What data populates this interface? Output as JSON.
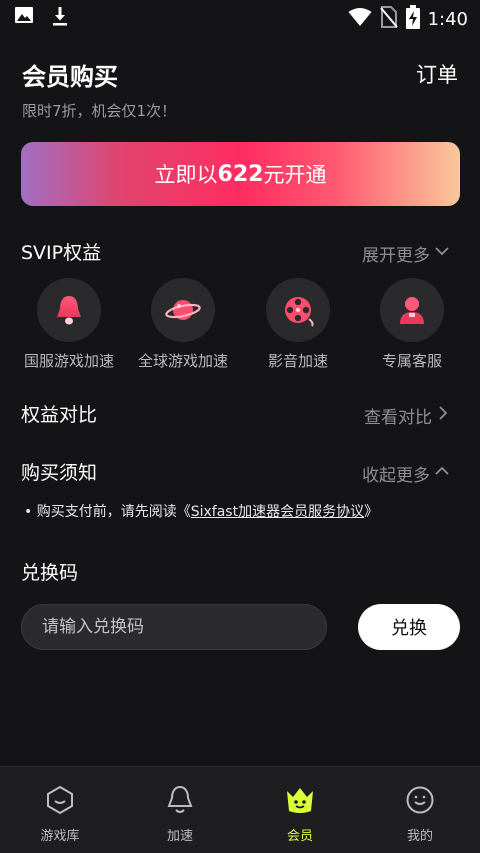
{
  "status_bar": {
    "time": "1:40",
    "left_icons": [
      "image-icon",
      "download-icon"
    ],
    "right_icons": [
      "wifi-icon",
      "no-sim-icon",
      "battery-charging-icon"
    ]
  },
  "header": {
    "title": "会员购买",
    "order_label": "订单",
    "subtitle": "限时7折，机会仅1次！"
  },
  "cta": {
    "prefix": "立即以",
    "price": "622",
    "suffix": "元开通"
  },
  "svip": {
    "title": "SVIP权益",
    "expand_label": "展开更多",
    "benefits": [
      {
        "label": "国服游戏加速",
        "icon": "bell-icon"
      },
      {
        "label": "全球游戏加速",
        "icon": "planet-icon"
      },
      {
        "label": "影音加速",
        "icon": "film-reel-icon"
      },
      {
        "label": "专属客服",
        "icon": "agent-icon"
      }
    ]
  },
  "compare": {
    "title": "权益对比",
    "link_label": "查看对比"
  },
  "purchase_notice": {
    "title": "购买须知",
    "collapse_label": "收起更多",
    "bullet": "•",
    "text_prefix": "购买支付前，请先阅读《",
    "agreement_link": "Sixfast加速器会员服务协议",
    "text_suffix": "》"
  },
  "redeem": {
    "title": "兑换码",
    "placeholder": "请输入兑换码",
    "button_label": "兑换"
  },
  "tabbar": {
    "items": [
      {
        "label": "游戏库",
        "icon": "game-library-icon",
        "active": false
      },
      {
        "label": "加速",
        "icon": "accelerate-icon",
        "active": false
      },
      {
        "label": "会员",
        "icon": "member-icon",
        "active": true
      },
      {
        "label": "我的",
        "icon": "profile-icon",
        "active": false
      }
    ]
  },
  "colors": {
    "background": "#141416",
    "accent_active": "#d8ff3a",
    "cta_gradient": [
      "#a06fc4",
      "#ff2c60",
      "#f8c89a"
    ],
    "icon_accent": "#ff4d6d"
  }
}
